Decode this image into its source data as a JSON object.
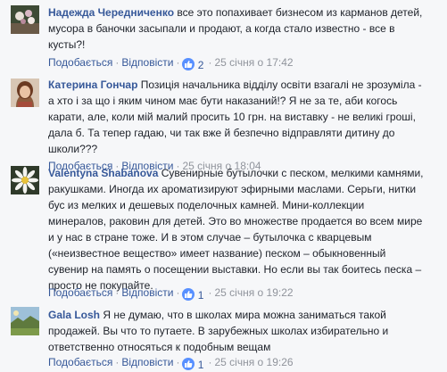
{
  "comments": [
    {
      "author": "Надежда Чередниченко",
      "lines": [
        "все это попахивает бизнесом из карманов детей,",
        "мусора в баночки засыпали и продают, а когда стало известно - все в",
        "кусты?!"
      ],
      "like_label": "Подобається",
      "reply_label": "Відповісти",
      "reactions": "2",
      "time": "25 січня о 17:42",
      "avatar_icon": "flower-photo-avatar"
    },
    {
      "author": "Катерина Гончар",
      "lines": [
        "Позиція начальника відділу освіти взагалі не зрозуміла -",
        "а хто і за що і яким чином має бути наказаний!? Я не за те, аби когось",
        "карати, але, коли мій малий просить 10 грн. на виставку - не великі гроші,",
        "дала б. Та тепер гадаю, чи так вже й безпечно відправляти дитину до",
        "школи???"
      ],
      "like_label": "Подобається",
      "reply_label": "Відповісти",
      "reactions": "",
      "time": "25 січня о 18:04",
      "avatar_icon": "woman-portrait-avatar"
    },
    {
      "author": "Valentyna Shabanova",
      "lines": [
        "Сувенирные бутылочки с песком, мелкими камнями,",
        "ракушками. Иногда их ароматизируют эфирными маслами. Серьги, нитки",
        "бус из мелких и дешевых поделочных камней. Мини-коллекции",
        "минералов, раковин для детей. Это во множестве продается во всем мире",
        "и у нас в стране тоже. И в этом случае – бутылочка с кварцевым",
        "(«неизвестное вещество» имеет название) песком – обыкновенный",
        "сувенир на память о посещении выставки. Но если вы так боитесь песка –",
        "просто не покупайте."
      ],
      "like_label": "Подобається",
      "reply_label": "Відповісти",
      "reactions": "1",
      "time": "25 січня о 19:22",
      "avatar_icon": "daisy-photo-avatar"
    },
    {
      "author": "Gala Losh",
      "lines": [
        "Я не думаю, что в школах мира можна заниматься такой",
        "продажей. Вы что то путаете. В зарубежных школах избирательно и",
        "ответственно относяться к подобным вещам"
      ],
      "like_label": "Подобається",
      "reply_label": "Відповісти",
      "reactions": "1",
      "time": "25 січня о 19:26",
      "avatar_icon": "landscape-photo-avatar"
    }
  ],
  "colors": {
    "link": "#365899",
    "text": "#1d2129",
    "meta": "#90949c",
    "like_badge": "#5890ff"
  }
}
